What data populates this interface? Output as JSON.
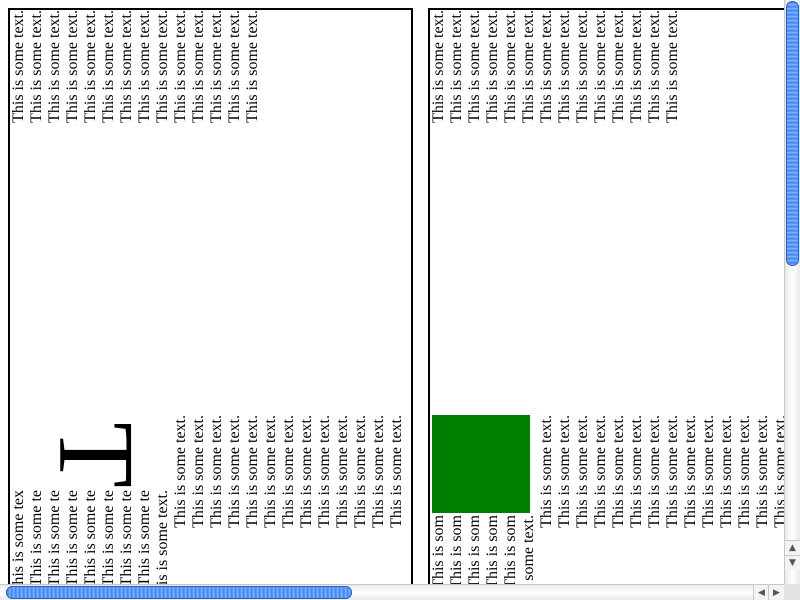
{
  "line_text": "This is some text.",
  "clipped_left": "his is some tex",
  "clipped_right": "This is som",
  "clipped_short": "This is some te",
  "drop_cap": "T",
  "colors": {
    "green_box": "#008000",
    "scroll_thumb": "#3f84f0"
  },
  "scroll": {
    "up": "▲",
    "down": "▼",
    "left": "◀",
    "right": "▶"
  }
}
